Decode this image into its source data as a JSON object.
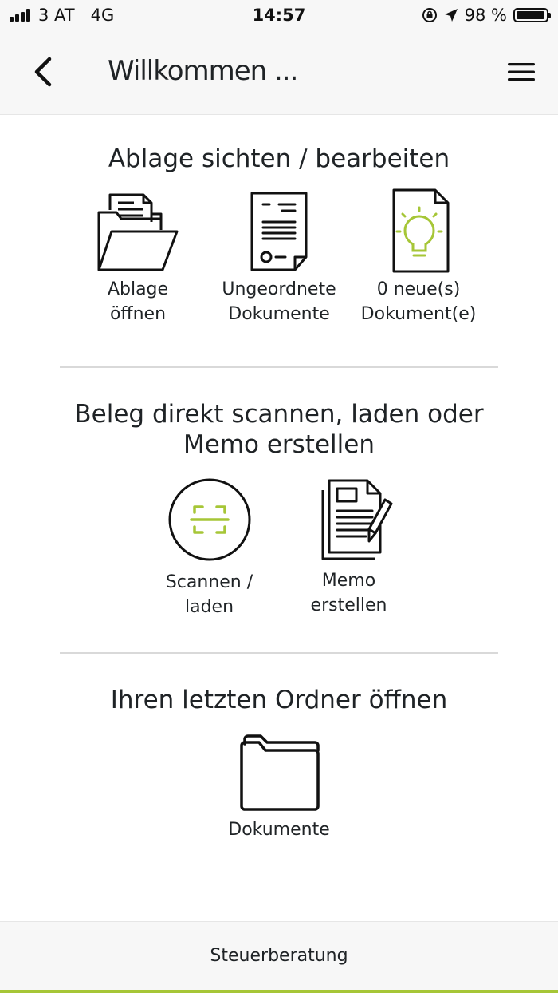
{
  "status_bar": {
    "carrier": "3 AT",
    "network": "4G",
    "time": "14:57",
    "battery_percent": "98 %",
    "battery_level": 0.98,
    "icons": [
      "signal-bars-icon",
      "rotation-lock-icon",
      "location-arrow-icon",
      "battery-icon"
    ]
  },
  "nav": {
    "title": "Willkommen ...",
    "back_icon": "chevron-left-icon",
    "menu_icon": "hamburger-menu-icon"
  },
  "section_review": {
    "title": "Ablage sichten / bearbeiten",
    "tiles": [
      {
        "label": "Ablage\nöffnen",
        "icon": "open-folder-icon"
      },
      {
        "label": "Ungeordnete\nDokumente",
        "icon": "document-icon"
      },
      {
        "label": "0 neue(s)\nDokument(e)",
        "icon": "lightbulb-document-icon"
      }
    ]
  },
  "section_scan": {
    "title": "Beleg direkt scannen, laden oder\nMemo erstellen",
    "tiles": [
      {
        "label": "Scannen /\nladen",
        "icon": "scan-icon"
      },
      {
        "label": "Memo\nerstellen",
        "icon": "memo-pen-icon"
      }
    ]
  },
  "section_last_folder": {
    "title": "Ihren letzten Ordner öffnen",
    "tile": {
      "label": "Dokumente",
      "icon": "folder-icon"
    }
  },
  "footer": {
    "label": "Steuerberatung"
  },
  "colors": {
    "accent": "#a6c637",
    "bar_bg": "#f7f7f7",
    "text": "#1f2326",
    "divider": "#d9d9d9"
  }
}
